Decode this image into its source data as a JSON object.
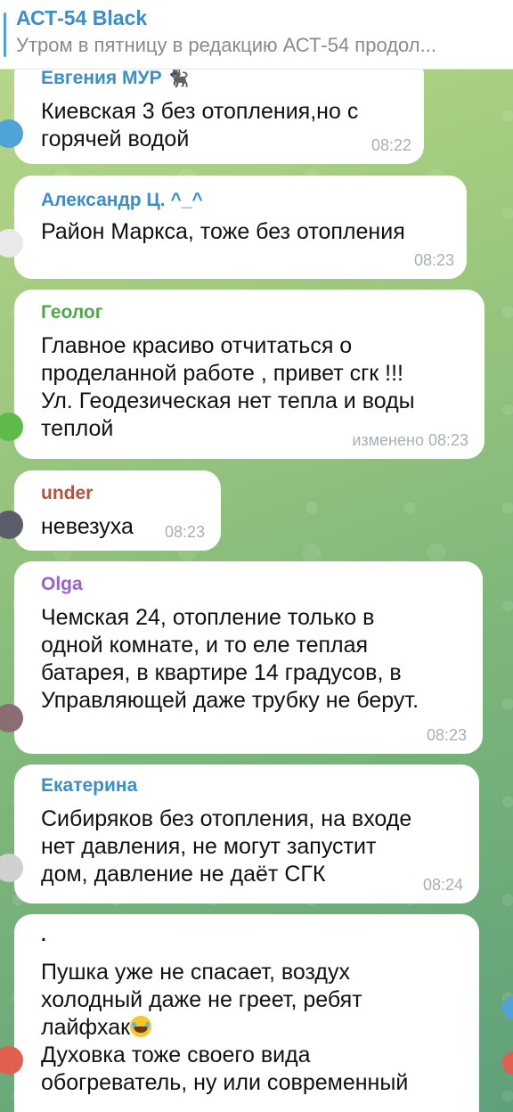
{
  "pinned": {
    "title": "АСТ-54 Black",
    "text": "Утром в пятницу в редакцию АСТ-54 продол..."
  },
  "colors": {
    "accent": "#3a8fc8",
    "sender_evgeniya": "#3a8fc8",
    "sender_aleksandr": "#3a8fc8",
    "sender_geolog": "#4ea84a",
    "sender_under": "#b5533c",
    "sender_olga": "#9a5fd0",
    "sender_ekaterina": "#3a8fc8"
  },
  "messages": [
    {
      "sender": "Евгения МУР",
      "sender_icon": "black-cat-icon",
      "lines": [
        "Киевская 3 без отопления,но с",
        "горячей водой"
      ],
      "time": "08:22"
    },
    {
      "sender": "Александр Ц. ^_^",
      "lines": [
        "Район Маркса, тоже без отопления"
      ],
      "time": "08:23"
    },
    {
      "sender": "Геолог",
      "lines": [
        "Главное красиво отчитаться о",
        "проделанной работе , привет сгк !!!",
        "Ул. Геодезическая нет тепла и воды",
        "теплой"
      ],
      "time": "изменено 08:23"
    },
    {
      "sender": "under",
      "lines": [
        "невезуха"
      ],
      "time": "08:23"
    },
    {
      "sender": "Olga",
      "lines": [
        "Чемская 24, отопление только в",
        "одной комнате,  и то еле теплая",
        "батарея, в квартире 14 градусов,  в",
        "Управляющей даже трубку не берут."
      ],
      "time": "08:23"
    },
    {
      "sender": "Екатерина",
      "lines": [
        "Сибиряков без отопления, на входе",
        "нет давления, не могут запустит",
        "дом, давление не даёт СГК"
      ],
      "time": "08:24"
    },
    {
      "sender": ".",
      "lines": [
        "Пушка уже не спасает, воздух",
        "холодный даже не греет, ребят",
        "лайфхак",
        "Духовка тоже своего вида",
        "обогреватель, ну или современный"
      ],
      "emoji_icon": "laughing-crying-face-icon"
    }
  ]
}
